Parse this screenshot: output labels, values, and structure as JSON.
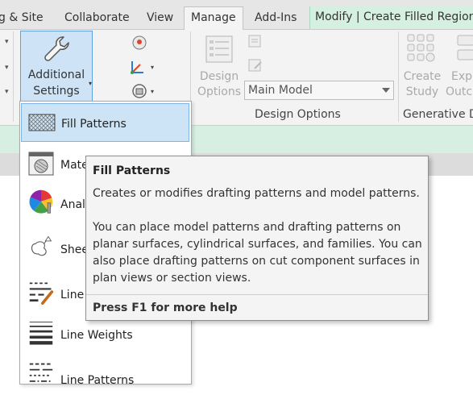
{
  "tabs": [
    {
      "label": "g & Site"
    },
    {
      "label": "Collaborate"
    },
    {
      "label": "View"
    },
    {
      "label": "Manage",
      "active": true
    },
    {
      "label": "Add-Ins"
    },
    {
      "label": "Modify | Create Filled Region",
      "contextual": true
    }
  ],
  "ribbon": {
    "additional_settings": {
      "line1": "Additional",
      "line2": "Settings"
    },
    "design_options_btn": {
      "line1": "Design",
      "line2": "Options"
    },
    "main_model_select": {
      "value": "Main Model"
    },
    "panel_design_options": "Design Options",
    "create_study": {
      "line1": "Create",
      "line2": "Study"
    },
    "explore_outcomes": {
      "line1": "Exp",
      "line2": "Outco"
    },
    "panel_generative": "Generative D"
  },
  "dropdown": {
    "items": [
      {
        "label": "Fill Patterns",
        "icon": "fill-patterns-icon",
        "highlighted": true
      },
      {
        "label": "Mate",
        "icon": "materials-icon"
      },
      {
        "label": "Analy",
        "icon": "analysis-display-styles-icon"
      },
      {
        "label": "Shee",
        "icon": "sheet-issues-icon"
      },
      {
        "label": "Line",
        "icon": "line-styles-icon"
      },
      {
        "label": "Line Weights",
        "icon": "line-weights-icon"
      },
      {
        "label": "Line Patterns",
        "icon": "line-patterns-icon"
      }
    ]
  },
  "tooltip": {
    "title": "Fill Patterns",
    "summary": "Creates or modifies drafting patterns and model patterns.",
    "body": "You can place model patterns and drafting patterns on planar surfaces, cylindrical surfaces, and families. You can also place drafting patterns on cut component surfaces in plan views or section views.",
    "help": "Press F1 for more help"
  },
  "colors": {
    "accent": "#5ea0e0",
    "contextual_tab": "#d5f0e1",
    "highlight": "#cde4f7"
  }
}
